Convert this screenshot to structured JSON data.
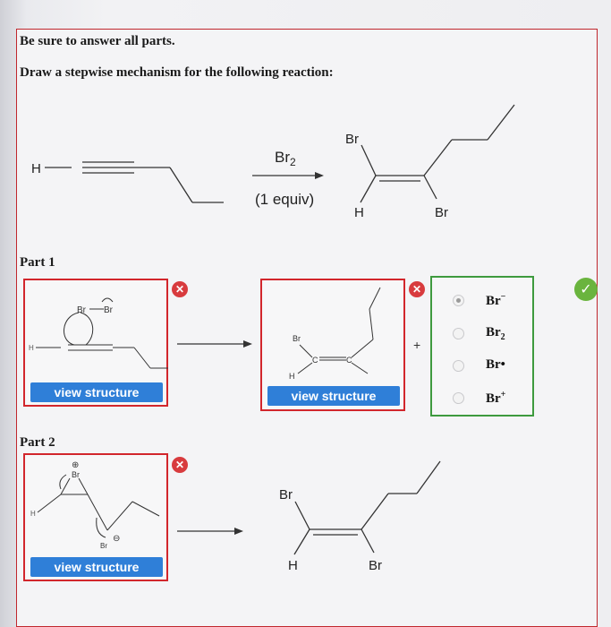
{
  "instructions": {
    "line1": "Be sure to answer all parts.",
    "line2": "Draw a stepwise mechanism for the following reaction:"
  },
  "reaction": {
    "reactant_h": "H",
    "reagent": "Br",
    "reagent_sub": "2",
    "conditions": "(1 equiv)",
    "product_br_top": "Br",
    "product_h": "H",
    "product_br_bottom": "Br"
  },
  "part1": {
    "label": "Part 1",
    "box1": {
      "view_button": "view structure",
      "h_label": "H",
      "br_left": "Br",
      "br_right": "Br"
    },
    "box2": {
      "view_button": "view structure",
      "br_label": "Br",
      "h_label": "H",
      "c1": "C",
      "c2": "C"
    },
    "plus": "+",
    "options": [
      {
        "label": "Br",
        "sup": "−",
        "sub": "",
        "selected": true
      },
      {
        "label": "Br",
        "sup": "",
        "sub": "2",
        "selected": false
      },
      {
        "label": "Br•",
        "sup": "",
        "sub": "",
        "selected": false
      },
      {
        "label": "Br",
        "sup": "+",
        "sub": "",
        "selected": false
      }
    ],
    "close_icon": "✕",
    "check_icon": "✓"
  },
  "part2": {
    "label": "Part 2",
    "box1": {
      "view_button": "view structure",
      "h_label": "H",
      "br_top": "Br",
      "br_bottom": "Br",
      "plus_charge": "⊕",
      "minus_charge": "⊖"
    },
    "product_br": "Br",
    "product_h": "H",
    "product_br_bottom": "Br",
    "close_icon": "✕"
  },
  "colors": {
    "error_red": "#d2262c",
    "correct_green": "#3e9a3e",
    "button_blue": "#2f7fd8"
  }
}
